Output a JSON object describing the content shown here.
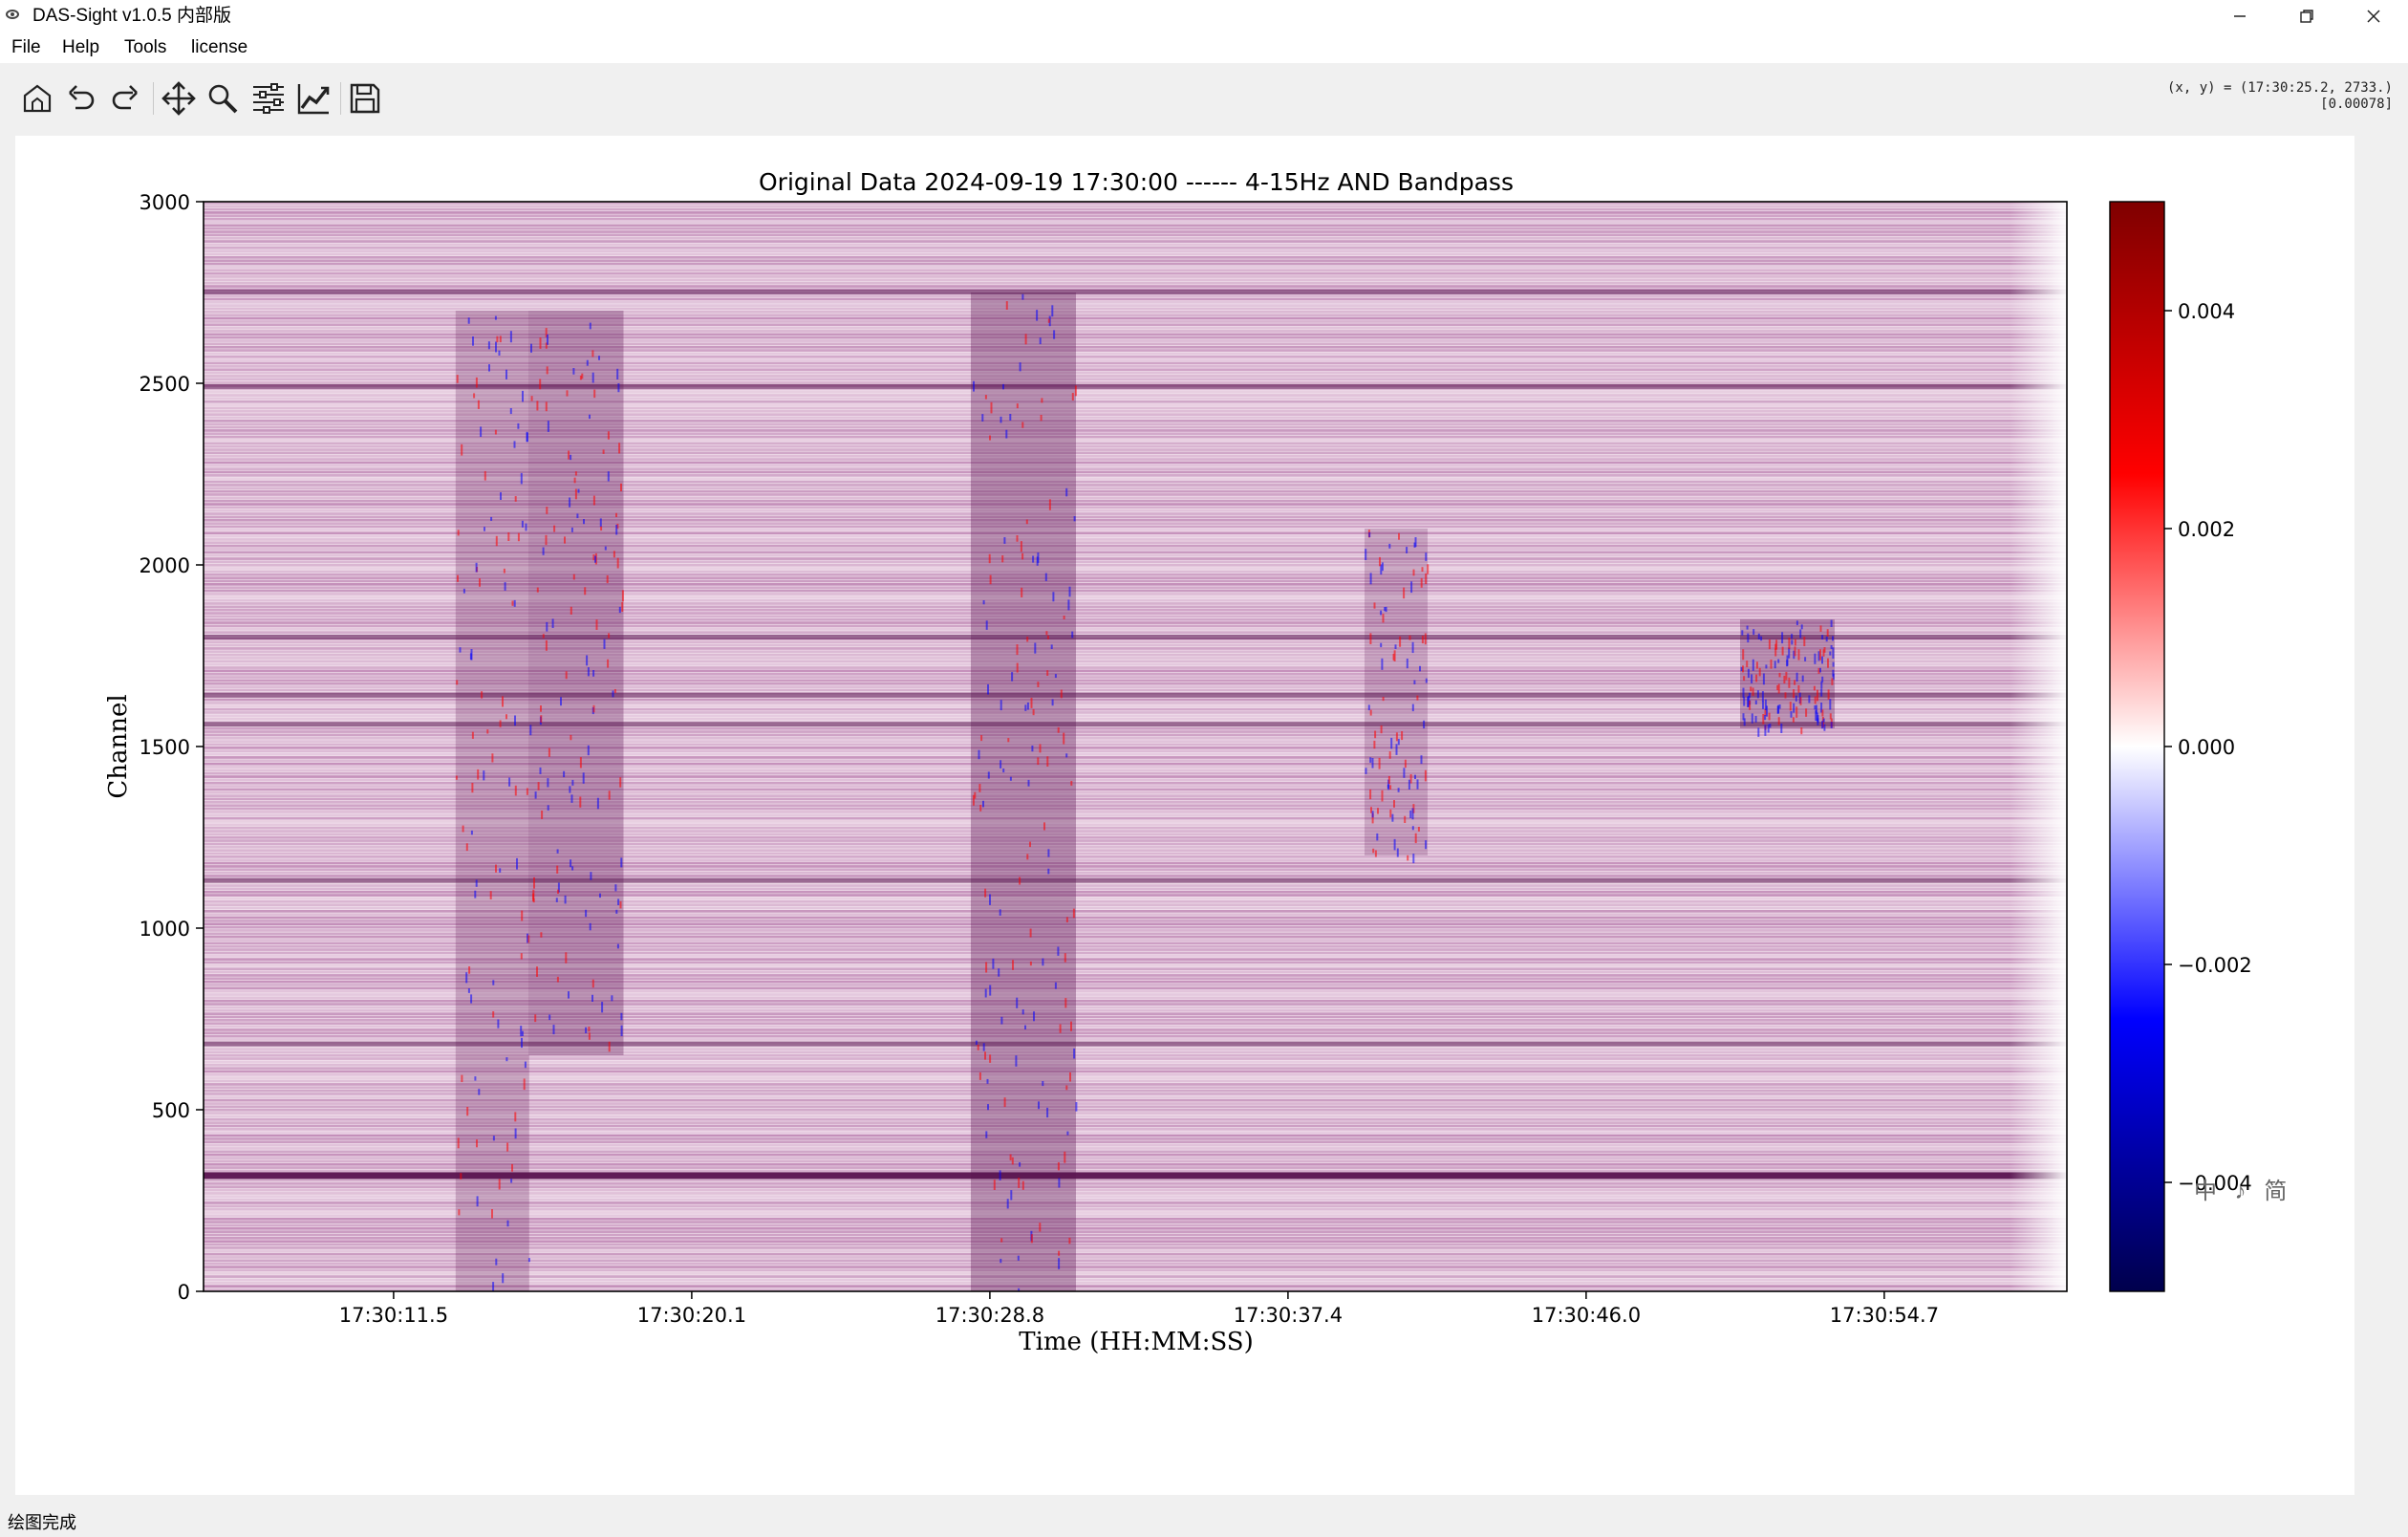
{
  "window": {
    "title": "DAS-Sight v1.0.5 内部版"
  },
  "menu": {
    "items": [
      "File",
      "Help",
      "Tools",
      "license"
    ]
  },
  "toolbar": {
    "tools": [
      "home-icon",
      "back-icon",
      "forward-icon",
      "pan-icon",
      "zoom-icon",
      "configure-subplots-icon",
      "edit-axes-icon",
      "save-icon"
    ],
    "coord_readout_line1": "(x, y) = (17:30:25.2, 2733.)",
    "coord_readout_line2": "[0.00078]"
  },
  "chart_data": {
    "type": "heatmap",
    "title": "Original Data 2024-09-19 17:30:00 ------ 4-15Hz AND Bandpass",
    "xlabel": "Time (HH:MM:SS)",
    "ylabel": "Channel",
    "x_tick_labels": [
      "17:30:11.5",
      "17:30:20.1",
      "17:30:28.8",
      "17:30:37.4",
      "17:30:46.0",
      "17:30:54.7"
    ],
    "y_ticks": [
      0,
      500,
      1000,
      1500,
      2000,
      2500,
      3000
    ],
    "ylim": [
      0,
      3000
    ],
    "colormap": "seismic",
    "colorbar_ticks": [
      "0.004",
      "0.002",
      "0.000",
      "−0.002",
      "−0.004"
    ],
    "colorbar_range": [
      -0.005,
      0.005
    ],
    "colormap_colors": [
      "#00004c",
      "#0000ff",
      "#ffffff",
      "#ff0000",
      "#7f0000"
    ],
    "noise_color": "#8a2a7a",
    "event_color": "#5a1450",
    "events": [
      {
        "time_frac": 0.155,
        "channel_range": [
          0,
          2700
        ],
        "strength": 0.7
      },
      {
        "time_frac": 0.2,
        "channel_range": [
          650,
          2700
        ],
        "strength": 0.9
      },
      {
        "time_frac": 0.44,
        "channel_range": [
          0,
          2750
        ],
        "strength": 1.0
      },
      {
        "time_frac": 0.64,
        "channel_range": [
          1200,
          2100
        ],
        "strength": 0.6
      },
      {
        "time_frac": 0.85,
        "channel_range": [
          1550,
          1850
        ],
        "strength": 0.9
      }
    ],
    "strong_band_channels": [
      320,
      680,
      1640,
      1560,
      1130,
      2490,
      2750,
      1800
    ]
  },
  "status": {
    "text": "绘图完成"
  },
  "ime": {
    "text": "中 ♪ 简"
  }
}
